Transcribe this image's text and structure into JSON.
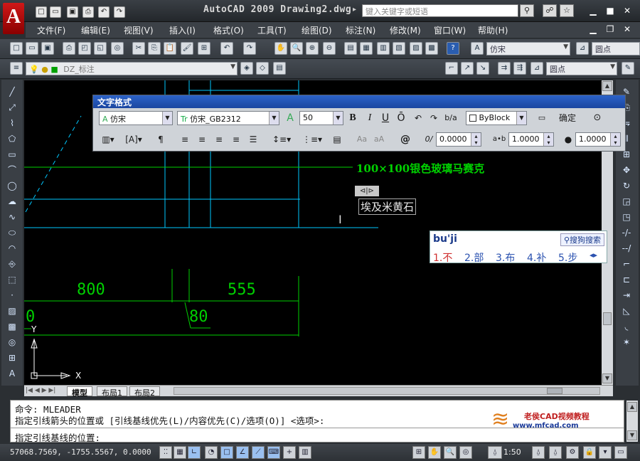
{
  "title_bar": {
    "logo_letter": "A",
    "title": "AutoCAD 2009  Drawing2.dwg",
    "search_placeholder": "键入关键字或短语",
    "quick_access": [
      "□",
      "▭",
      "▣",
      "⎙",
      "↶",
      "↷"
    ]
  },
  "menu": {
    "items": [
      "文件(F)",
      "编辑(E)",
      "视图(V)",
      "插入(I)",
      "格式(O)",
      "工具(T)",
      "绘图(D)",
      "标注(N)",
      "修改(M)",
      "窗口(W)",
      "帮助(H)"
    ]
  },
  "toolbar_standard": {
    "style_combo": "仿宋",
    "dim_combo": "圆点"
  },
  "toolbar_layers": {
    "layer_combo": "DZ_标注",
    "right_combo": "圆点"
  },
  "text_format": {
    "title": "文字格式",
    "style": "仿宋",
    "font": "仿宋_GB2312",
    "height": "50",
    "bold": "B",
    "italic": "I",
    "underline": "U",
    "overline": "Ō",
    "color": "ByBlock",
    "ok_label": "确定",
    "oblique_value": "0.0000",
    "tracking_value": "1.0000",
    "width_value": "1.0000",
    "at_symbol": "@",
    "oblique_symbol": "0/",
    "tracking_symbol": "a•b",
    "width_symbol": "●",
    "aa_labels": [
      "Aa",
      "aA"
    ]
  },
  "drawing": {
    "label_glass": "100×100银色玻璃马赛克",
    "label_editing": "埃及米黄石",
    "dims": [
      "800",
      "555",
      "80",
      "0"
    ],
    "axis_y": "Y",
    "axis_x": "X",
    "editor_toggle": "⊲|⊳",
    "line_color": "#00d000",
    "cyan_color": "#00c8ff"
  },
  "ime": {
    "input": "bu'ji",
    "search": "搜狗搜索",
    "candidates": [
      "1.不",
      "2.部",
      "3.布",
      "4.补",
      "5.步"
    ]
  },
  "tabs": [
    "模型",
    "布局1",
    "布局2"
  ],
  "command": {
    "line1": "命令:  MLEADER",
    "line2": "指定引线箭头的位置或 [引线基线优先(L)/内容优先(C)/选项(O)] <选项>:",
    "line3": "指定引线基线的位置:",
    "watermark_title": "老侯CAD视频教程",
    "watermark_url": "www.mfcad.com"
  },
  "status": {
    "coords": "57068.7569, -1755.5567, 0.0000",
    "scale": "1:50"
  }
}
